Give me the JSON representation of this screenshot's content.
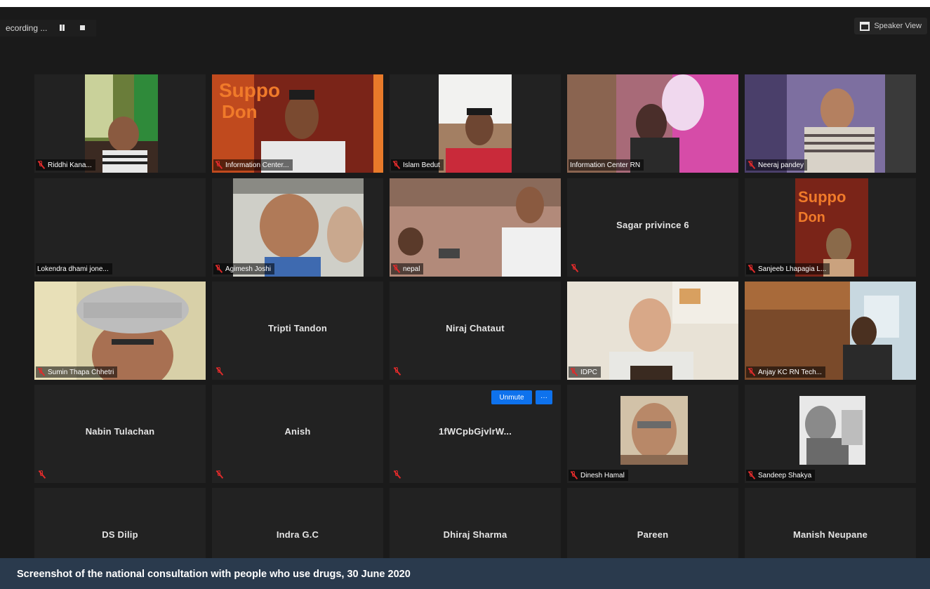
{
  "recording": {
    "status": "ecording ..."
  },
  "view": {
    "label": "Speaker View"
  },
  "tiles": [
    {
      "name": "Riddhi Kana..."
    },
    {
      "name": "Information Center..."
    },
    {
      "name": "Islam Bedut"
    },
    {
      "name": "Information Center RN"
    },
    {
      "name": "Neeraj pandey"
    },
    {
      "name": "Lokendra dhami jone..."
    },
    {
      "name": "Agimesh Joshi"
    },
    {
      "name": "nepal"
    },
    {
      "name": "Sagar privince 6"
    },
    {
      "name": "Sanjeeb Lhapagia L..."
    },
    {
      "name": "Sumin Thapa Chhetri"
    },
    {
      "name": "Tripti Tandon"
    },
    {
      "name": "Niraj Chataut"
    },
    {
      "name": "IDPC"
    },
    {
      "name": "Anjay KC RN Tech..."
    },
    {
      "name": "Nabin Tulachan"
    },
    {
      "name": "Anish"
    },
    {
      "name": "1fWCpbGjvlrW..."
    },
    {
      "name": "Dinesh Hamal"
    },
    {
      "name": "Sandeep Shakya"
    },
    {
      "name": "DS Dilip"
    },
    {
      "name": "Indra G.C"
    },
    {
      "name": "Dhiraj Sharma"
    },
    {
      "name": "Pareen"
    },
    {
      "name": "Manish Neupane"
    }
  ],
  "buttons": {
    "unmute": "Unmute",
    "more": "···"
  },
  "caption": "Screenshot of the national consultation with people who use drugs, 30 June 2020"
}
